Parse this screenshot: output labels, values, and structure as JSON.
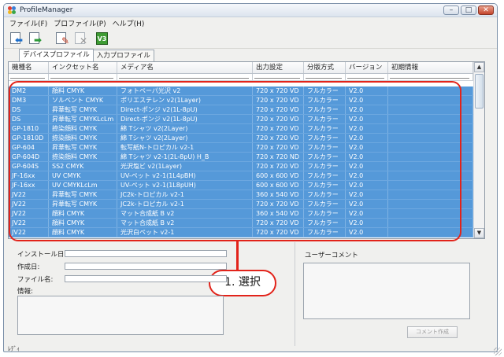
{
  "window": {
    "title": "ProfileManager",
    "buttons": [
      "–",
      "□",
      "✕"
    ]
  },
  "menu": [
    "ファイル(F)",
    "プロファイル(P)",
    "ヘルプ(H)"
  ],
  "toolbar": {
    "icons": [
      "import-profile-icon",
      "export-profile-icon",
      "profile-settings-icon",
      "delete-profile-icon",
      "v3-icon"
    ],
    "v3_label": "V3"
  },
  "tabs": [
    "デバイスプロファイル",
    "入力プロファイル"
  ],
  "table": {
    "columns": [
      "機種名",
      "インクセット名",
      "メディア名",
      "出力設定",
      "分版方式",
      "バージョン",
      "初期情報"
    ],
    "rows": [
      [
        "DM2",
        "顔料 CMYK",
        "フォトペーパ光沢 v2",
        "720 x 720 VD",
        "フルカラー",
        "V2.0",
        ""
      ],
      [
        "DM3",
        "ソルベント CMYK",
        "ポリエステレン v2(1Layer)",
        "720 x 720 VD",
        "フルカラー",
        "V2.0",
        ""
      ],
      [
        "DS",
        "昇華転写 CMYK",
        "Direct-ポンジ v2(1L-8pU)",
        "720 x 720 VD",
        "フルカラー",
        "V2.0",
        ""
      ],
      [
        "DS",
        "昇華転写 CMYKLcLm",
        "Direct-ポンジ v2(1L-8pU)",
        "720 x 720 VD",
        "フルカラー",
        "V2.0",
        ""
      ],
      [
        "GP-1810",
        "捺染顔料 CMYK",
        "綿 Tシャツ v2(2Layer)",
        "720 x 720 VD",
        "フルカラー",
        "V2.0",
        ""
      ],
      [
        "GP-1810D",
        "捺染顔料 CMYK",
        "綿 Tシャツ v2(2Layer)",
        "720 x 720 VD",
        "フルカラー",
        "V2.0",
        ""
      ],
      [
        "GP-604",
        "昇華転写 CMYK",
        "転写紙N-トロピカル v2-1",
        "720 x 720 VD",
        "フルカラー",
        "V2.0",
        ""
      ],
      [
        "GP-604D",
        "捺染顔料 CMYK",
        "綿 Tシャツ v2-1(2L-8pU) H_B",
        "720 x 720 ND",
        "フルカラー",
        "V2.0",
        ""
      ],
      [
        "GP-604S",
        "SS2 CMYK",
        "光沢塩ビ v2(1Layer)",
        "720 x 720 VD",
        "フルカラー",
        "V2.0",
        ""
      ],
      [
        "JF-16xx",
        "UV CMYK",
        "UV-ペット v2-1(1L4pBH)",
        "600 x 600 VD",
        "フルカラー",
        "V2.0",
        ""
      ],
      [
        "JF-16xx",
        "UV CMYKLcLm",
        "UV-ペット v2-1(1L8pUH)",
        "600 x 600 VD",
        "フルカラー",
        "V2.0",
        ""
      ],
      [
        "JV22",
        "昇華転写 CMYK",
        "JC2k-トロピカル v2-1",
        "360 x 540 VD",
        "フルカラー",
        "V2.0",
        ""
      ],
      [
        "JV22",
        "昇華転写 CMYK",
        "JC2k-トロピカル v2-1",
        "720 x 720 VD",
        "フルカラー",
        "V2.0",
        ""
      ],
      [
        "JV22",
        "顔料 CMYK",
        "マット合成紙 B v2",
        "360 x 540 VD",
        "フルカラー",
        "V2.0",
        ""
      ],
      [
        "JV22",
        "顔料 CMYK",
        "マット合成紙 B v2",
        "720 x 720 VD",
        "フルカラー",
        "V2.0",
        ""
      ],
      [
        "JV22",
        "顔料 CMYK",
        "光沢白ペット v2-1",
        "720 x 720 VD",
        "フルカラー",
        "V2.0",
        ""
      ]
    ]
  },
  "info": {
    "install_date_label": "インストール日:",
    "created_date_label": "作成日:",
    "file_name_label": "ファイル名:",
    "info_label": "情報:",
    "user_comment_label": "ユーザーコメント",
    "comment_button": "コメント作成"
  },
  "annotation": {
    "callout": "1. 選択"
  },
  "status": "ﾚﾃﾞｨ",
  "colors": {
    "selection": "#5599d9",
    "annotation": "#e2231a"
  }
}
